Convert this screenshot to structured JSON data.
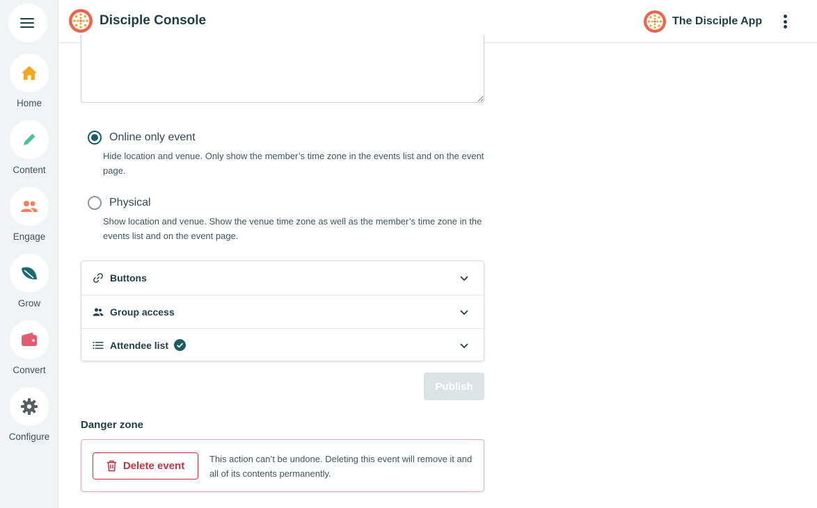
{
  "header": {
    "title": "Disciple Console",
    "app_name": "The Disciple App"
  },
  "sidebar": {
    "items": [
      {
        "label": "Home",
        "icon": "home-icon",
        "color": "#f6a623"
      },
      {
        "label": "Content",
        "icon": "pencil-icon",
        "color": "#4dbf94"
      },
      {
        "label": "Engage",
        "icon": "people-icon",
        "color": "#f0825f"
      },
      {
        "label": "Grow",
        "icon": "leaf-icon",
        "color": "#1a6b73"
      },
      {
        "label": "Convert",
        "icon": "wallet-icon",
        "color": "#e35d72"
      },
      {
        "label": "Configure",
        "icon": "gear-icon",
        "color": "#555e63"
      }
    ]
  },
  "form": {
    "description_value": "",
    "event_type": {
      "selected": "online",
      "options": [
        {
          "label": "Online only event",
          "description": "Hide location and venue. Only show the member’s time zone in the events list and on the event page."
        },
        {
          "label": "Physical",
          "description": "Show location and venue. Show the venue time zone as well as the member’s time zone in the events list and on the event page."
        }
      ]
    },
    "sections": [
      {
        "label": "Buttons",
        "icon": "link-icon",
        "complete": false
      },
      {
        "label": "Group access",
        "icon": "people-icon",
        "complete": false
      },
      {
        "label": "Attendee list",
        "icon": "list-icon",
        "complete": true
      }
    ],
    "publish_label": "Publish"
  },
  "danger_zone": {
    "title": "Danger zone",
    "delete_label": "Delete event",
    "warning": "This action can’t be undone. Deleting this event will remove it and all of its contents permanently."
  },
  "colors": {
    "accent": "#1a5c63",
    "danger": "#c8323f",
    "logo": "#e8654f"
  }
}
